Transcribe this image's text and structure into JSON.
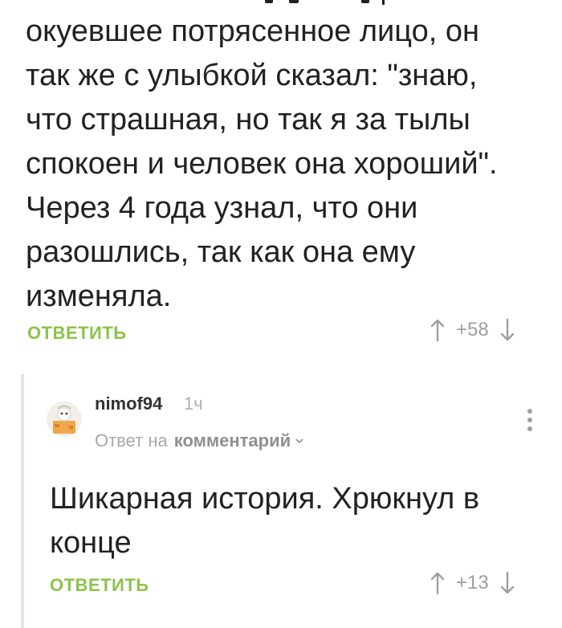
{
  "comment1": {
    "lines": [
      "окуевшее потрясенное лицо, он",
      "так же с улыбкой сказал: \"знаю,",
      "что страшная, но так я за тылы",
      "спокоен и человек она хороший\".",
      "Через 4 года узнал, что они",
      "разошлись, так как она ему",
      "изменяла."
    ],
    "reply_label": "ОТВЕТИТЬ",
    "votes": "+58"
  },
  "comment2": {
    "username": "nimof94",
    "time": "1ч",
    "reply_prefix": "Ответ на",
    "reply_target": "комментарий",
    "lines": [
      "Шикарная история. Хрюкнул в",
      "конце"
    ],
    "reply_label": "ОТВЕТИТЬ",
    "votes": "+13"
  },
  "colors": {
    "accent": "#8bc34a",
    "muted": "#9e9e9e",
    "thread_line": "#e6e6e6",
    "text": "#222222"
  },
  "icons": [
    "arrow-up-icon",
    "arrow-down-icon",
    "more-options-icon",
    "chevron-down-icon",
    "avatar-icon"
  ]
}
